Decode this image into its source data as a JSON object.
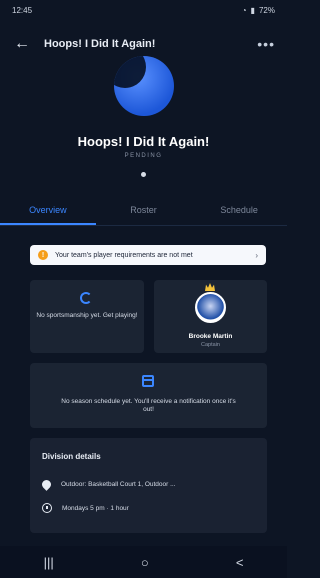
{
  "status_bar": {
    "time": "12:45",
    "battery": "72%"
  },
  "app_bar": {
    "title": "Hoops! I Did It Again!",
    "back_icon": "arrow-left-icon",
    "menu_icon": "more-horizontal-icon"
  },
  "team": {
    "name": "Hoops! I Did It Again!",
    "status": "PENDING"
  },
  "tabs": [
    {
      "label": "Overview",
      "active": true
    },
    {
      "label": "Roster",
      "active": false
    },
    {
      "label": "Schedule",
      "active": false
    }
  ],
  "alert": {
    "text": "Your team's player requirements are not met",
    "icon": "warning-icon"
  },
  "cards": {
    "sportsmanship": "No sportsmanship yet. Get playing!",
    "captain_name": "Brooke Martin",
    "captain_role": "Captain",
    "schedule": "No season schedule yet. You'll receive a notification once it's out!"
  },
  "division": {
    "title": "Division details",
    "location": "Outdoor: Basketball Court 1, Outdoor ...",
    "time": "Mondays 5 pm · 1 hour"
  },
  "bottom_nav": {
    "recents": "|||",
    "home": "○",
    "back": "<"
  }
}
